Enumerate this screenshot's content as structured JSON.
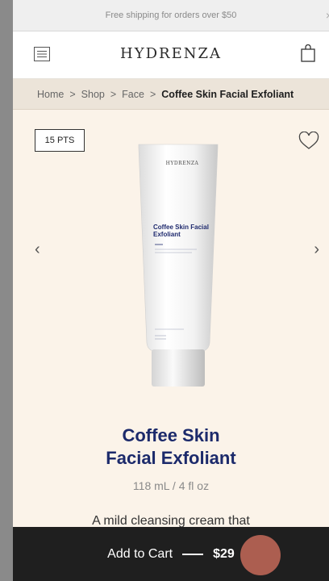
{
  "promo": {
    "text": "Free shipping for orders over $50",
    "close": "×"
  },
  "header": {
    "logo": "HYDRENZA",
    "menu_icon": "hamburger-menu-icon",
    "bag_icon": "shopping-bag-icon"
  },
  "breadcrumb": {
    "items": [
      "Home",
      "Shop",
      "Face"
    ],
    "current": "Coffee Skin Facial Exfoliant",
    "separator": ">"
  },
  "product": {
    "points_badge": "15 PTS",
    "tube_brand": "HYDRENZA",
    "tube_name": "Coffee Skin Facial Exfoliant",
    "title_line1": "Coffee Skin",
    "title_line2": "Facial Exfoliant",
    "size": "118 mL / 4 fl oz",
    "description": "A mild cleansing cream that",
    "prev_arrow": "‹",
    "next_arrow": "›"
  },
  "cta": {
    "label": "Add to Cart",
    "price": "$29"
  },
  "colors": {
    "accent": "#1c2a6b",
    "background": "#fbf3e9",
    "cta_bg": "#1f1f1f"
  }
}
